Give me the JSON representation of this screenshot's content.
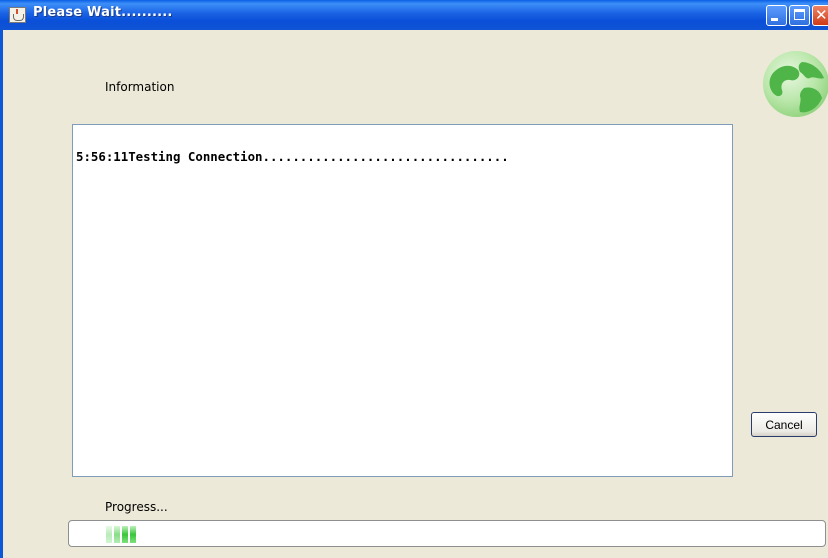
{
  "window": {
    "title": "Please Wait..........",
    "controls": {
      "minimize": "minimize",
      "maximize": "maximize",
      "close": "close"
    },
    "accent": "#0a4fd8"
  },
  "info": {
    "label": "Information"
  },
  "log": {
    "lines": [
      "5:56:11Testing Connection................................."
    ]
  },
  "cancel": {
    "label": "Cancel"
  },
  "progress": {
    "label": "Progress...",
    "mode": "indeterminate",
    "fill_color": "#39c63a"
  },
  "icons": {
    "title": "java-cup-icon",
    "status": "globe-icon"
  }
}
